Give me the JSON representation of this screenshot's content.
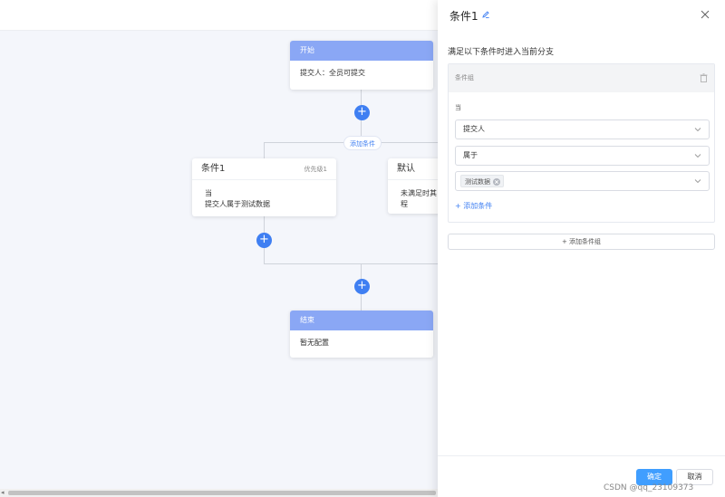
{
  "flow": {
    "start_node": {
      "title": "开始",
      "body": "提交人：全员可提交"
    },
    "add_condition_label": "添加条件",
    "branches": [
      {
        "title": "条件1",
        "priority": "优先级1",
        "line1": "当",
        "line2": "提交人属于测试数据"
      },
      {
        "title": "默认",
        "line1": "未满足时其",
        "line2": "程"
      }
    ],
    "end_node": {
      "title": "结束",
      "body": "暂无配置"
    },
    "plus_symbol": "+"
  },
  "drawer": {
    "title": "条件1",
    "description": "满足以下条件时进入当前分支",
    "group": {
      "title": "条件组",
      "when_label": "当",
      "field_select": "提交人",
      "operator_select": "属于",
      "value_tag": "测试数据",
      "add_condition_link": "+ 添加条件"
    },
    "add_group_button": "+ 添加条件组",
    "ok_button": "确定",
    "cancel_button": "取消"
  },
  "watermark": "CSDN @qq_23109373",
  "colors": {
    "accent": "#3f7ff2",
    "node_header": "#8aa7f5",
    "canvas_bg": "#f4f6fb",
    "primary_button": "#409eff"
  },
  "icons": [
    "edit-icon",
    "close-icon",
    "trash-icon",
    "chevron-down-icon",
    "tag-close-icon",
    "plus-icon"
  ]
}
